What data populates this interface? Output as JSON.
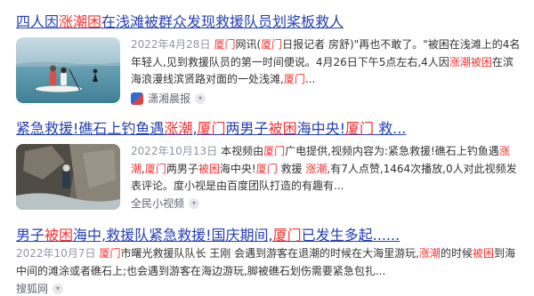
{
  "results": [
    {
      "title_parts": [
        "四人因",
        "涨潮困",
        "在浅滩被群众发现救援队员划桨板救人"
      ],
      "date": "2022年4月28日",
      "snippet_parts": [
        "厦门",
        "网讯(",
        "厦门",
        "日报记者 房舒)\"再也不敢了。\"被困在浅滩上的4名年轻人,见到救援队员的第一时间便说。4月26日下午5点左右,4人因",
        "涨潮被困",
        "在滨海浪漫线滨贤路对面的一处浅滩,",
        "厦门",
        "..."
      ],
      "source": "潇湘晨报",
      "thumb_desc": "people-on-paddleboard-image"
    },
    {
      "title_parts": [
        "紧急救援!礁石上钓鱼遇",
        "涨潮",
        ",",
        "厦门",
        "两男子",
        "被困",
        "海中央!",
        "厦门",
        " 救..."
      ],
      "date": "2022年10月13日",
      "snippet_parts": [
        "本视频由",
        "厦门",
        "广电提供,视频内容为:紧急救援!礁石上钓鱼遇",
        "涨潮",
        ",",
        "厦门",
        "两男子",
        "被困",
        "海中央!",
        "厦门",
        " 救援 ",
        "涨潮",
        ",有7人点赞,1464次播放,0人对此视频发表评论。度小视是由百度团队打造的有趣有..."
      ],
      "source": "全民小视频",
      "thumb_desc": "rock-rescue-video-image"
    },
    {
      "title_parts": [
        "男子",
        "被困",
        "海中,救援队紧急救援!国庆期间,",
        "厦门",
        "已发生多起......"
      ],
      "date": "2022年10月7日",
      "snippet_parts": [
        "厦门",
        "市曙光救援队队长 王刚 会遇到游客在退潮的时候在大海里游玩,",
        "涨潮",
        "的时候",
        "被困",
        "到海中间的滩涂或者礁石上;也会遇到游客在海边游玩,脚被礁石划伤需要紧急包扎..."
      ],
      "source": "搜狐网"
    }
  ],
  "icons": {
    "chevron": "chevron-down-icon"
  }
}
